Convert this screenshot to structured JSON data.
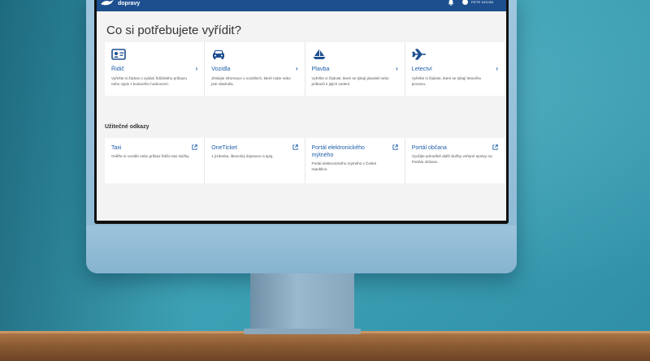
{
  "header": {
    "logo_text": "dopravy",
    "user_name": "PETR NOVÁK"
  },
  "page_title": "Co si potřebujete vyřídit?",
  "services": [
    {
      "title": "Řidič",
      "icon": "id-card-icon",
      "description": "Vyřešte si žádost o vydání řidičského průkazu nebo výpis z bodového hodnocení."
    },
    {
      "title": "Vozidla",
      "icon": "car-icon",
      "description": "Získejte informace o vozidlech, které máte nebo jste vlastnil/a."
    },
    {
      "title": "Plavba",
      "icon": "sailboat-icon",
      "description": "Vyřešte si žádosti, které se týkají plavidel nebo průkazů k jejich vedení."
    },
    {
      "title": "Letectví",
      "icon": "airplane-icon",
      "description": "Vyřešte si žádosti, které se týkají letového provozu."
    }
  ],
  "useful_links_title": "Užitečné odkazy",
  "links": [
    {
      "title": "Taxi",
      "description": "Ověřte si vozidlo nebo průkaz řidiče taxi služby."
    },
    {
      "title": "OneTicket",
      "description": "1 jízdenka, libovolný dopravce a spoj."
    },
    {
      "title": "Portál elektronického mýtného",
      "description": "Portál elektronického mýtného v České republice."
    },
    {
      "title": "Portál občana",
      "description": "Využijte pohodlně další služby veřejné správy na Portálu občana."
    }
  ],
  "colors": {
    "header": "#1d4f8f",
    "link": "#1d5ea8",
    "wall": "#2e8fa3"
  }
}
